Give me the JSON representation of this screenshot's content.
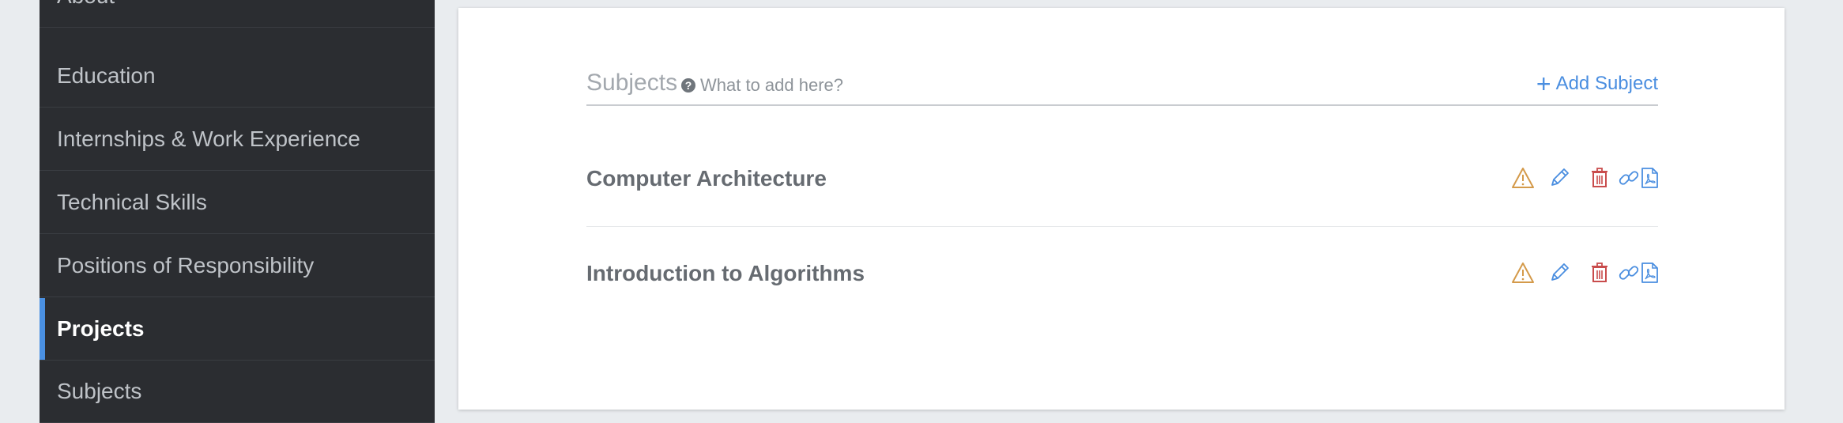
{
  "sidebar": {
    "items": [
      {
        "label": "About"
      },
      {
        "label": "Education"
      },
      {
        "label": "Internships & Work Experience"
      },
      {
        "label": "Technical Skills"
      },
      {
        "label": "Positions of Responsibility"
      },
      {
        "label": "Projects",
        "active": true
      },
      {
        "label": "Subjects"
      }
    ]
  },
  "panel": {
    "title": "Subjects",
    "help_text": "What to add here?",
    "help_icon": "question-circle-icon",
    "add_label": "Add Subject",
    "add_icon": "plus-icon",
    "subjects": [
      {
        "name": "Computer Architecture"
      },
      {
        "name": "Introduction to Algorithms"
      }
    ],
    "row_actions": [
      "warning-icon",
      "edit-pencil-icon",
      "delete-trash-icon",
      "link-icon",
      "pdf-icon"
    ]
  },
  "colors": {
    "sidebar_bg": "#2b2d31",
    "active_accent": "#4a90e2",
    "link_blue": "#4a8ee0",
    "warning": "#d49a4a",
    "danger": "#c94c4c",
    "page_bg": "#e9ecef"
  }
}
